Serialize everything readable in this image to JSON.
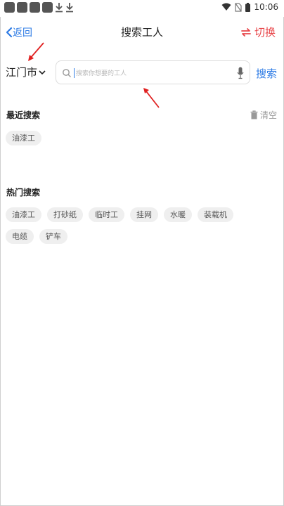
{
  "status_bar": {
    "time": "10:06",
    "icons": [
      "notification-icon",
      "notification-icon",
      "notification-icon",
      "notification-icon",
      "download-icon",
      "download-icon",
      "wifi-icon",
      "no-sim-icon",
      "battery-icon"
    ]
  },
  "nav": {
    "back_label": "返回",
    "title": "搜索工人",
    "switch_label": "切换"
  },
  "search": {
    "city": "江门市",
    "placeholder": "搜索你想要的工人",
    "button_label": "搜索"
  },
  "recent": {
    "title": "最近搜索",
    "clear_label": "清空",
    "tags": [
      "油漆工"
    ]
  },
  "hot": {
    "title": "热门搜索",
    "tags": [
      "油漆工",
      "打砂纸",
      "临时工",
      "挂网",
      "水暖",
      "装载机",
      "电缆",
      "铲车"
    ]
  },
  "colors": {
    "accent_blue": "#2f7ce5",
    "accent_red": "#e8464a",
    "annotation_arrow": "#e02020"
  }
}
